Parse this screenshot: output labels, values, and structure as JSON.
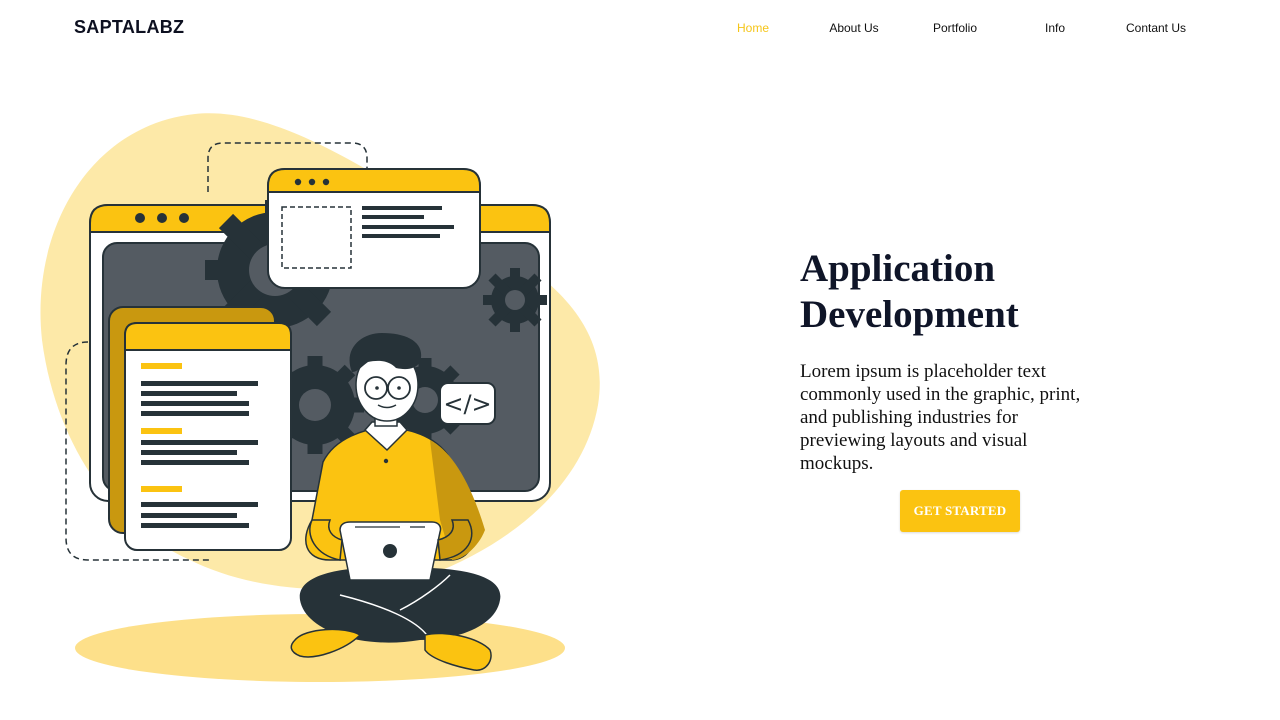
{
  "header": {
    "brand": "SAPTALABZ",
    "nav": [
      {
        "label": "Home",
        "active": true
      },
      {
        "label": "About Us",
        "active": false
      },
      {
        "label": "Portfolio",
        "active": false
      },
      {
        "label": "Info",
        "active": false
      },
      {
        "label": "Contant Us",
        "active": false
      }
    ]
  },
  "hero": {
    "title_line1": "Application",
    "title_line2": "Development",
    "description": "Lorem ipsum is placeholder text commonly used in the graphic, print, and publishing industries for previewing layouts and visual mockups.",
    "cta_label": "GET STARTED",
    "illustration": {
      "code_badge": "</>",
      "icons": [
        "developer-illustration",
        "gear-icon",
        "laptop-icon",
        "code-icon"
      ]
    }
  },
  "colors": {
    "accent": "#fbc311",
    "accent_light": "#fde9a8",
    "dark": "#263238",
    "screen": "#545b62",
    "text": "#0f1528"
  }
}
